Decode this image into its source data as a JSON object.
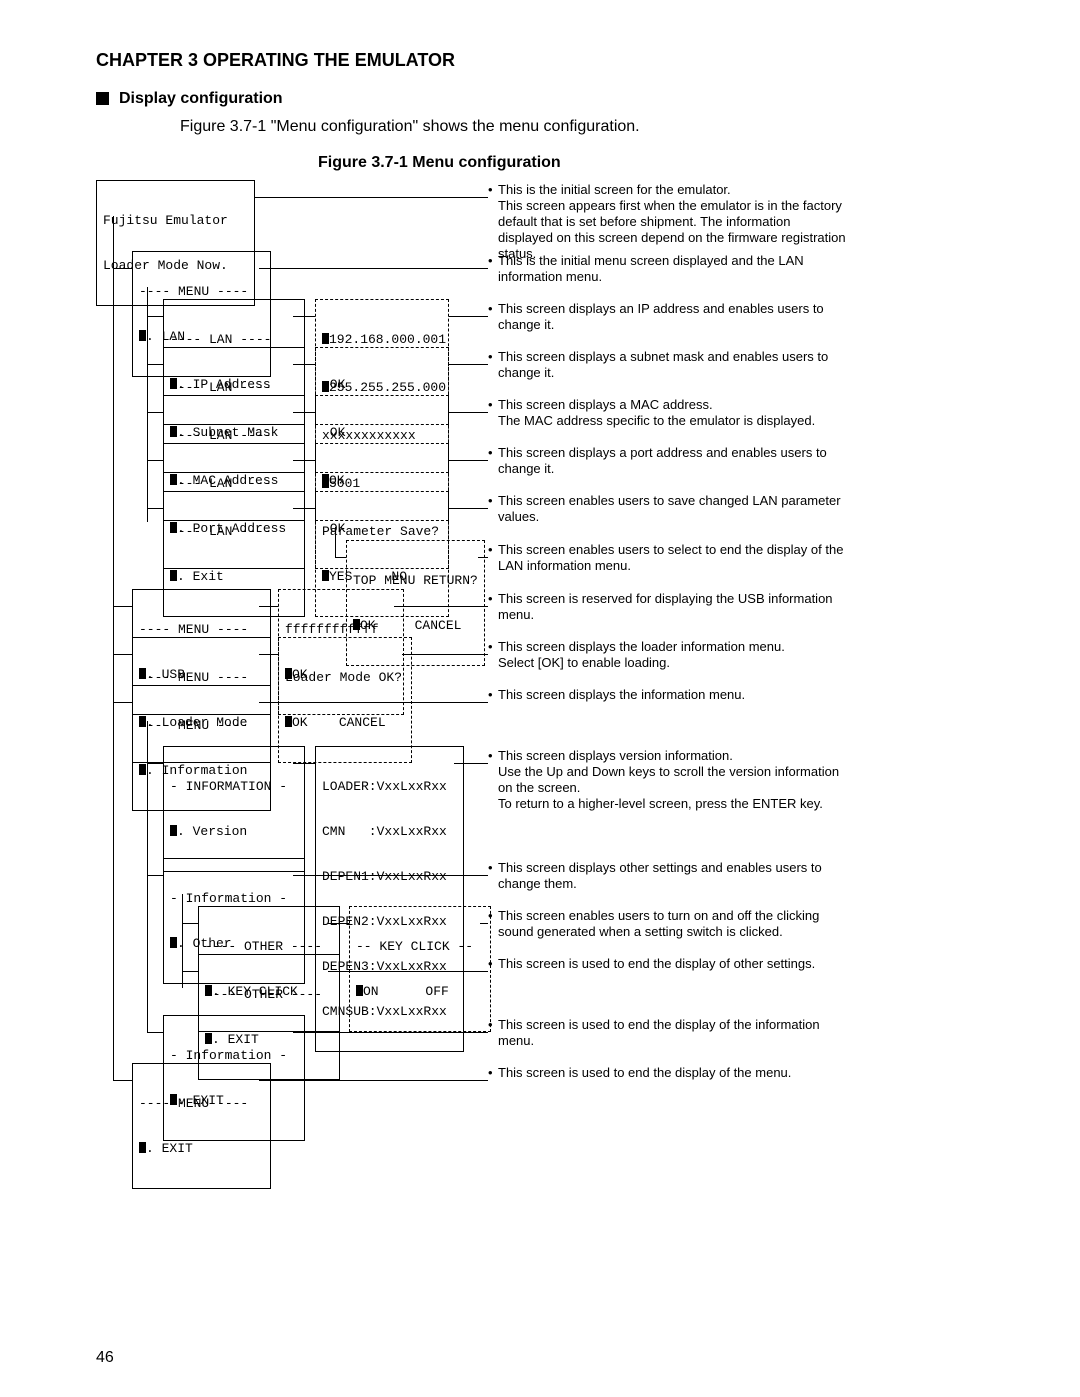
{
  "chapter": "CHAPTER 3  OPERATING THE EMULATOR",
  "section": "Display configuration",
  "intro": "Figure 3.7-1 \"Menu configuration\" shows the menu configuration.",
  "figure": "Figure 3.7-1  Menu configuration",
  "pagenum": "46",
  "root_l1": "Fujitsu Emulator",
  "root_l2": "Loader Mode Now.",
  "menu_lan_h": "---- MENU ----",
  "menu_lan_i": ". LAN",
  "lan_ip_h": "---- LAN ----",
  "lan_ip_i": ". IP Address",
  "lan_ip_v1": "192.168.000.001",
  "lan_ip_v2": " OK",
  "lan_sm_h": "---- LAN ----",
  "lan_sm_i": ". Subnet Mask",
  "lan_sm_v1": "255.255.255.000",
  "lan_sm_v2": " OK",
  "lan_mac_h": "---- LAN ----",
  "lan_mac_i": ". MAC Address",
  "lan_mac_v1": "xxxxxxxxxxxx",
  "lan_mac_v2": "OK",
  "lan_port_h": "---- LAN  ---",
  "lan_port_i": ". Port Address",
  "lan_port_v1": "5001",
  "lan_port_v2": " OK",
  "lan_exit_h": "---- LAN ----",
  "lan_exit_i": ". Exit",
  "lan_exit_v1": "Parameter Save?",
  "lan_exit_v2a": "YES",
  "lan_exit_v2b": "NO",
  "top_v1": "TOP MENU RETURN?",
  "top_v2a": "OK",
  "top_v2b": "CANCEL",
  "menu_usb_h": "---- MENU ----",
  "menu_usb_i": ". USB",
  "usb_v1": "ffffffffffff",
  "usb_v2": "OK",
  "menu_loader_h": "---- MENU ----",
  "menu_loader_i": ". Loader Mode",
  "loader_v1": "Loader Mode OK?",
  "loader_v2a": "OK",
  "loader_v2b": "CANCEL",
  "menu_info_h": "---- MENU ----",
  "menu_info_i": ". Information",
  "info_ver_h": "- INFORMATION -",
  "info_ver_i": ". Version",
  "ver_l1": "LOADER:VxxLxxRxx",
  "ver_l2": "CMN   :VxxLxxRxx",
  "ver_l3": "DEPEN1:VxxLxxRxx",
  "ver_l4": "DEPEN2:VxxLxxRxx",
  "ver_l5": "DEPEN3:VxxLxxRxx",
  "ver_l6": "CMNSUB:VxxLxxRxx",
  "info_other_h": "- Information -",
  "info_other_i": ". Other",
  "other_kc_h": "---- OTHER ----",
  "other_kc_i": ". KEY CLICK",
  "kc_v1": "-- KEY CLICK --",
  "kc_v2a": "ON",
  "kc_v2b": "OFF",
  "other_exit_h": "---- OTHER ----",
  "other_exit_i": ". EXIT",
  "info_exit_h": "- Information -",
  "info_exit_i": ". EXIT",
  "menu_exit_h": "---- MENU ----",
  "menu_exit_i": ". EXIT",
  "d_root_a": "This is the initial screen for the emulator.",
  "d_root_b": "This screen appears first when the emulator is in the factory default that is set before shipment.  The information displayed on this screen depend on the firmware registration status.",
  "d_lan": "This is the initial menu screen displayed and the LAN information menu.",
  "d_ip": "This screen displays an IP address and enables users to change it.",
  "d_sm": "This screen displays a subnet mask and enables users to change it.",
  "d_mac_a": "This screen displays a MAC address.",
  "d_mac_b": "The MAC address specific to the emulator is displayed.",
  "d_port": "This screen displays a port address and enables users to change it.",
  "d_exit": "This screen enables users to save changed LAN parameter values.",
  "d_top": "This screen enables users to select to end the display of the LAN information menu.",
  "d_usb": "This screen is reserved for displaying the USB information menu.",
  "d_loader_a": "This screen displays the loader information menu.",
  "d_loader_b": "Select [OK] to enable loading.",
  "d_info": "This screen displays the information menu.",
  "d_ver_a": "This screen displays version information.",
  "d_ver_b": "Use the Up and Down keys to scroll the version information on the screen.",
  "d_ver_c": "To return to a higher-level screen, press the ENTER key.",
  "d_other": "This screen displays other settings and enables users to change them.",
  "d_kc": "This screen enables users to turn on and off the clicking sound generated when a setting switch is clicked.",
  "d_otherexit": "This screen is used to end the display of other settings.",
  "d_infoexit": "This screen is used to end the display of the information menu.",
  "d_menuexit": "This screen is used to end the display of the menu."
}
